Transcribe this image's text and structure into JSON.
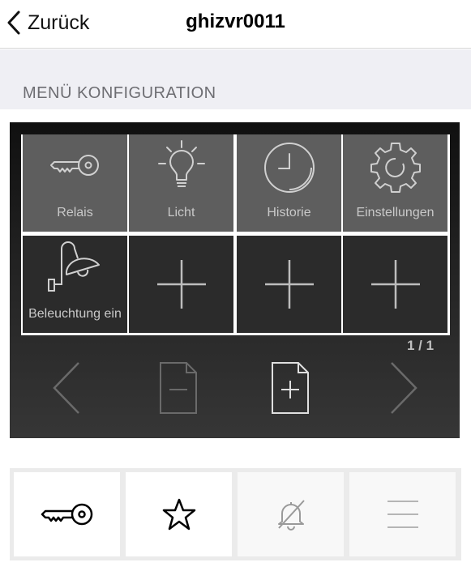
{
  "nav": {
    "back_label": "Zurück",
    "title": "ghizvr0011"
  },
  "section": {
    "title": "MENÜ KONFIGURATION"
  },
  "menu": {
    "tiles": [
      {
        "label": "Relais",
        "icon": "key-icon"
      },
      {
        "label": "Licht",
        "icon": "lightbulb-icon"
      },
      {
        "label": "Historie",
        "icon": "clock-icon"
      },
      {
        "label": "Einstellungen",
        "icon": "gear-icon"
      },
      {
        "label": "Beleuchtung ein",
        "icon": "wall-lamp-icon"
      },
      {
        "label": "",
        "icon": "plus-icon"
      },
      {
        "label": "",
        "icon": "plus-icon"
      },
      {
        "label": "",
        "icon": "plus-icon"
      }
    ],
    "page_indicator": "1 / 1"
  },
  "tabbar": {
    "tabs": [
      {
        "icon": "key-icon",
        "selected": true
      },
      {
        "icon": "star-icon",
        "selected": false
      },
      {
        "icon": "bell-off-icon",
        "selected": false
      },
      {
        "icon": "menu-lines-icon",
        "selected": false
      }
    ]
  },
  "colors": {
    "active_tile": "#5e5e5e",
    "empty_tile": "#2b2b2b",
    "background_grey": "#efeff4"
  }
}
